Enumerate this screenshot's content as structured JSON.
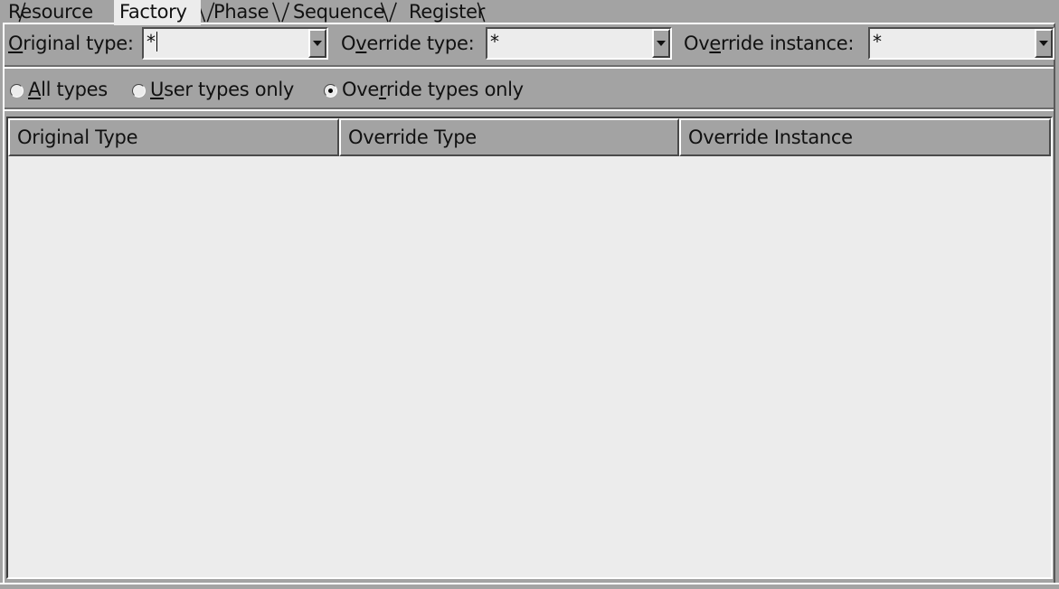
{
  "tabs": [
    {
      "label": "Resource",
      "selected": false
    },
    {
      "label": "Factory",
      "selected": true
    },
    {
      "label": "Phase",
      "selected": false
    },
    {
      "label": "Sequence",
      "selected": false
    },
    {
      "label": "Register",
      "selected": false
    }
  ],
  "filters": {
    "original_type": {
      "label_pre": "",
      "mnemonic": "O",
      "label_post": "riginal type:",
      "value": "*"
    },
    "override_type": {
      "label_pre": "O",
      "mnemonic": "v",
      "label_post": "erride type:",
      "value": "*"
    },
    "override_instance": {
      "label_pre": "Ov",
      "mnemonic": "e",
      "label_post": "rride instance:",
      "value": "*"
    }
  },
  "radios": {
    "all_types": {
      "pre": "",
      "mnemonic": "A",
      "post": "ll types",
      "selected": false
    },
    "user_types": {
      "pre": "",
      "mnemonic": "U",
      "post": "ser types only",
      "selected": false
    },
    "override_types": {
      "pre": "Ove",
      "mnemonic": "r",
      "post": "ride types only",
      "selected": true
    }
  },
  "table": {
    "columns": [
      "Original Type",
      "Override Type",
      "Override Instance"
    ],
    "rows": []
  },
  "colors": {
    "background": "#a3a3a3",
    "field": "#ececec"
  }
}
